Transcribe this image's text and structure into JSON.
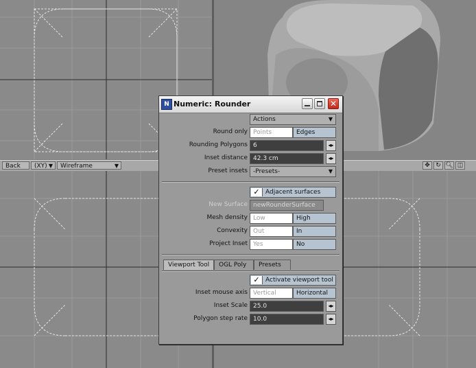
{
  "viewport_bar": {
    "view_button": "Back",
    "axis_dropdown": "(XY)",
    "render_dropdown": "Wireframe",
    "icons": [
      "move-icon",
      "rotate-icon",
      "zoom-icon",
      "maximize-icon"
    ]
  },
  "dialog": {
    "title": "Numeric: Rounder",
    "actions_dropdown": "Actions",
    "round_only": {
      "label": "Round only",
      "options": [
        "Points",
        "Edges"
      ],
      "selected": "Edges"
    },
    "rounding_polygons": {
      "label": "Rounding Polygons",
      "value": "6"
    },
    "inset_distance": {
      "label": "Inset distance",
      "value": "42.3 cm"
    },
    "preset_insets": {
      "label": "Preset insets",
      "value": "-Presets-"
    },
    "adjacent_surfaces": {
      "label": "Adjacent surfaces",
      "checked": true
    },
    "new_surface": {
      "label": "New Surface",
      "value": "newRounderSurface"
    },
    "mesh_density": {
      "label": "Mesh density",
      "options": [
        "Low",
        "High"
      ],
      "selected": "High"
    },
    "convexity": {
      "label": "Convexity",
      "options": [
        "Out",
        "In"
      ],
      "selected": "In"
    },
    "project_inset": {
      "label": "Project Inset",
      "options": [
        "Yes",
        "No"
      ],
      "selected": "No"
    },
    "tabs": [
      "Viewport Tool",
      "OGL Poly",
      "Presets"
    ],
    "active_tab": "Viewport Tool",
    "activate_viewport_tool": {
      "label": "Activate viewport tool",
      "checked": true
    },
    "inset_mouse_axis": {
      "label": "Inset mouse axis",
      "options": [
        "Vertical",
        "Horizontal"
      ],
      "selected": "Horizontal"
    },
    "inset_scale": {
      "label": "Inset Scale",
      "value": "25.0"
    },
    "polygon_step_rate": {
      "label": "Polygon step rate",
      "value": "10.0"
    }
  }
}
